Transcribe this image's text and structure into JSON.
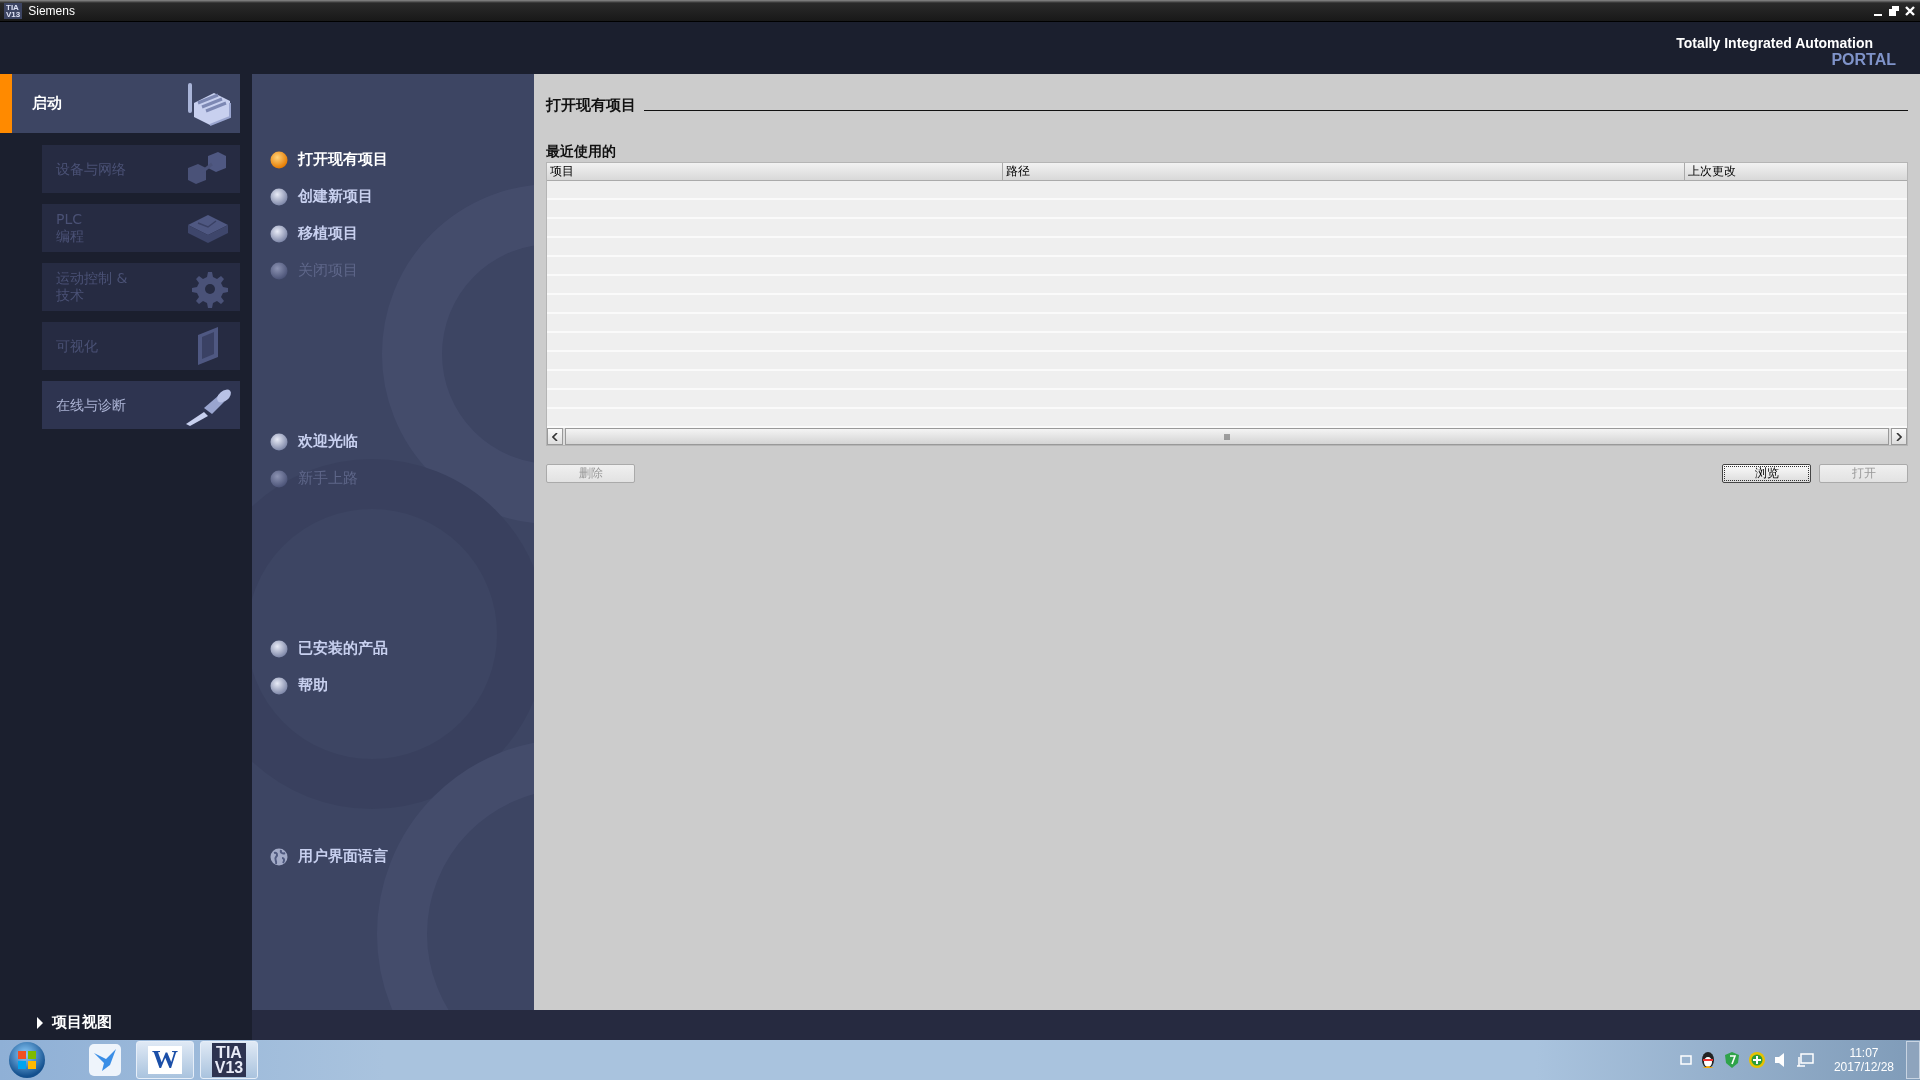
{
  "window": {
    "logo": [
      "TIA",
      "V13"
    ],
    "title": "Siemens"
  },
  "header": {
    "brand": "Totally Integrated Automation",
    "product": "PORTAL"
  },
  "portals": [
    {
      "label": "启动",
      "selected": true,
      "disabled": false
    },
    {
      "label": "设备与网络",
      "selected": false,
      "disabled": true
    },
    {
      "label": "PLC\n编程",
      "selected": false,
      "disabled": true
    },
    {
      "label": "运动控制 &\n技术",
      "selected": false,
      "disabled": true
    },
    {
      "label": "可视化",
      "selected": false,
      "disabled": true
    },
    {
      "label": "在线与诊断",
      "selected": false,
      "disabled": false
    }
  ],
  "action_groups": [
    {
      "items": [
        {
          "label": "打开现有项目",
          "selected": true,
          "disabled": false,
          "kind": "bullet"
        },
        {
          "label": "创建新项目",
          "selected": false,
          "disabled": false,
          "kind": "bullet"
        },
        {
          "label": "移植项目",
          "selected": false,
          "disabled": false,
          "kind": "bullet"
        },
        {
          "label": "关闭项目",
          "selected": false,
          "disabled": true,
          "kind": "bullet"
        }
      ]
    },
    {
      "items": [
        {
          "label": "欢迎光临",
          "selected": false,
          "disabled": false,
          "kind": "bullet"
        },
        {
          "label": "新手上路",
          "selected": false,
          "disabled": true,
          "kind": "bullet"
        }
      ]
    },
    {
      "items": [
        {
          "label": "已安装的产品",
          "selected": false,
          "disabled": false,
          "kind": "bullet"
        },
        {
          "label": "帮助",
          "selected": false,
          "disabled": false,
          "kind": "bullet"
        }
      ]
    },
    {
      "items": [
        {
          "label": "用户界面语言",
          "selected": false,
          "disabled": false,
          "kind": "globe"
        }
      ]
    }
  ],
  "content": {
    "title": "打开现有项目",
    "recent_label": "最近使用的",
    "table": {
      "columns": [
        "项目",
        "路径",
        "上次更改"
      ]
    },
    "left_buttons": [
      {
        "label": "删除",
        "disabled": true
      }
    ],
    "right_buttons": [
      {
        "label": "浏览",
        "disabled": false
      },
      {
        "label": "打开",
        "disabled": true
      }
    ]
  },
  "footer": {
    "project_view": "项目视图"
  },
  "taskbar": {
    "items": [
      {
        "kind": "bird"
      },
      {
        "kind": "word",
        "glyph": "W"
      },
      {
        "kind": "tia",
        "glyph": [
          "TIA",
          "V13"
        ]
      }
    ],
    "time": "11:07",
    "date": "2017/12/28"
  }
}
